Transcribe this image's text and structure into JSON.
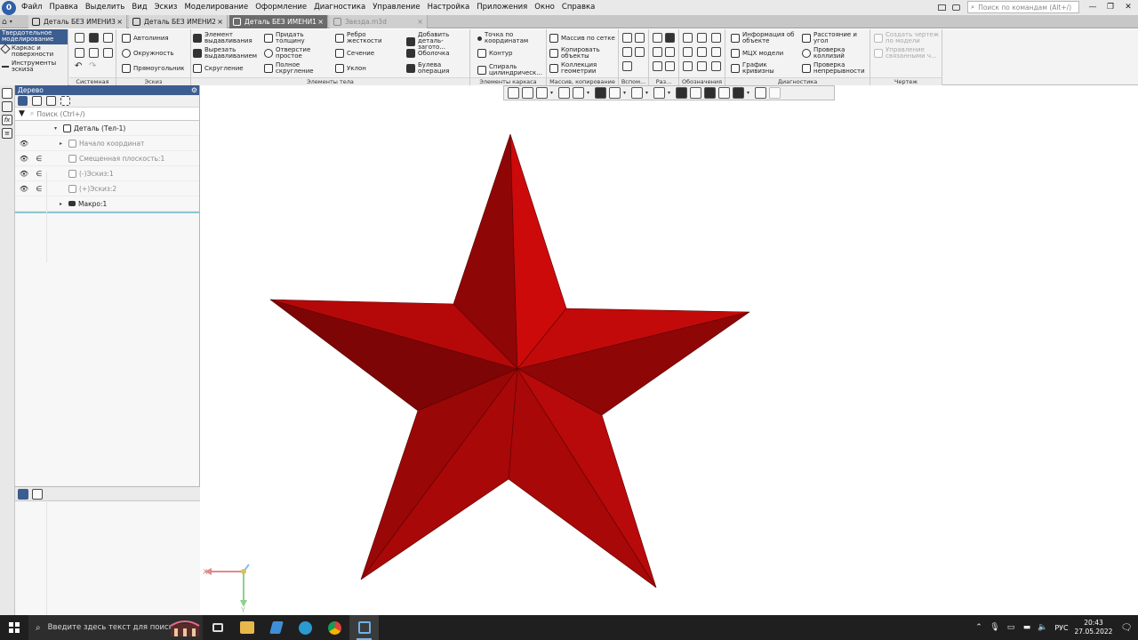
{
  "menu": {
    "logo_letter": "0",
    "items": [
      "Файл",
      "Правка",
      "Выделить",
      "Вид",
      "Эскиз",
      "Моделирование",
      "Оформление",
      "Диагностика",
      "Управление",
      "Настройка",
      "Приложения",
      "Окно",
      "Справка"
    ],
    "search_placeholder": "Поиск по командам (Alt+/)"
  },
  "tabs": [
    {
      "label": "Деталь БЕЗ ИМЕНИ3",
      "state": "normal"
    },
    {
      "label": "Деталь БЕЗ ИМЕНИ2",
      "state": "normal"
    },
    {
      "label": "Деталь БЕЗ ИМЕНИ1",
      "state": "active"
    },
    {
      "label": "Звезда.m3d",
      "state": "dim"
    }
  ],
  "tab_close_glyph": "×",
  "ribbon": {
    "modes": [
      "Твердотельное моделирование",
      "Каркас и поверхности",
      "Инструменты эскиза"
    ],
    "groups": {
      "system": "Системная",
      "sketch": "Эскиз",
      "body_elements": "Элементы тела",
      "frame_elements": "Элементы каркаса",
      "array_copy": "Массив, копирование",
      "aux": "Вспом...",
      "sizes": "Раз...",
      "notations": "Обозначения",
      "diagnostics": "Диагностика",
      "drawing": "Чертеж"
    },
    "sketch_buttons": [
      "Автолиния",
      "Окружность",
      "Прямоугольник"
    ],
    "body_buttons": {
      "extrude": "Элемент выдавливания",
      "cut_extrude": "Вырезать выдавливанием",
      "fillet": "Скругление",
      "thicken": "Придать толщину",
      "hole": "Отверстие простое",
      "full_fillet": "Полное скругление",
      "rib": "Ребро жесткости",
      "section": "Сечение",
      "draft": "Уклон",
      "add_part": "Добавить деталь-загото...",
      "shell": "Оболочка",
      "boolean": "Булева операция"
    },
    "frame_buttons": {
      "point": "Точка по координатам",
      "contour": "Контур",
      "helix": "Спираль цилиндрическ..."
    },
    "array_buttons": {
      "grid_array": "Массив по сетке",
      "copy": "Копировать объекты",
      "collection": "Коллекция геометрии"
    },
    "diag_buttons": {
      "info": "Информация об объекте",
      "mcx": "МЦХ модели",
      "curvature": "График кривизны",
      "distance": "Расстояние и угол",
      "collisions": "Проверка коллизий",
      "continuity": "Проверка непрерывности"
    },
    "drawing_buttons": {
      "create": "Создать чертеж по модели",
      "manage": "Управление связанными ч..."
    }
  },
  "tree": {
    "title": "Дерево",
    "search_placeholder": "Поиск (Ctrl+/)",
    "nodes": [
      {
        "label": "Деталь (Тел-1)",
        "eye": "",
        "eps": "",
        "dim": false,
        "level": 0,
        "expander": "▾"
      },
      {
        "label": "Начало координат",
        "eye": "👁",
        "eps": "",
        "dim": true,
        "level": 1,
        "expander": "▸"
      },
      {
        "label": "Смещенная плоскость:1",
        "eye": "👁",
        "eps": "∈",
        "dim": true,
        "level": 1,
        "expander": ""
      },
      {
        "label": "(-)Эскиз:1",
        "eye": "👁",
        "eps": "∈",
        "dim": true,
        "level": 1,
        "expander": ""
      },
      {
        "label": "(+)Эскиз:2",
        "eye": "👁",
        "eps": "∈",
        "dim": true,
        "level": 1,
        "expander": ""
      },
      {
        "label": "Макро:1",
        "eye": "",
        "eps": "",
        "dim": false,
        "level": 1,
        "expander": "▸"
      }
    ]
  },
  "viewport": {
    "model_color": "#c00a0a",
    "axis_x_label": "X",
    "axis_y_label": "Y"
  },
  "taskbar": {
    "search_placeholder": "Введите здесь текст для поиска",
    "language": "РУС",
    "time": "20:43",
    "date": "27.05.2022"
  }
}
